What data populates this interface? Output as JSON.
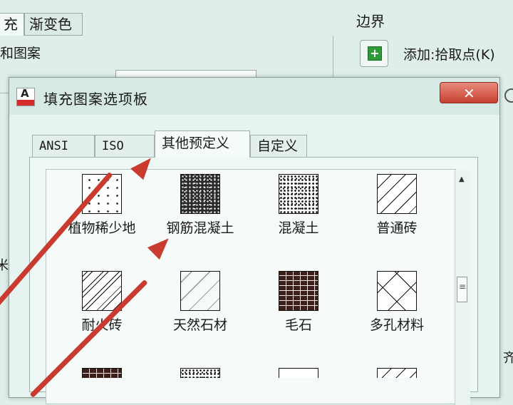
{
  "background": {
    "tab_fill": "充",
    "tab_gradient": "渐变色",
    "section_label": "和图案",
    "boundary_label": "边界",
    "add_pick_label": "添加:拾取点(K)",
    "side_char_1": "米",
    "side_char_2": "齐"
  },
  "dialog": {
    "title": "填充图案选项板",
    "close_symbol": "✕",
    "tabs": [
      {
        "label": "ANSI"
      },
      {
        "label": "ISO"
      },
      {
        "label": "其他预定义"
      },
      {
        "label": "自定义"
      }
    ],
    "active_tab": "其他预定义",
    "patterns": [
      {
        "label": "植物稀少地"
      },
      {
        "label": "钢筋混凝土"
      },
      {
        "label": "混凝土"
      },
      {
        "label": "普通砖"
      },
      {
        "label": "耐火砖"
      },
      {
        "label": "天然石材"
      },
      {
        "label": "毛石"
      },
      {
        "label": "多孔材料"
      }
    ]
  },
  "colors": {
    "annotation_arrow": "#c93a2f",
    "close_button": "#c7402f",
    "add_icon": "#2f9a3a"
  }
}
